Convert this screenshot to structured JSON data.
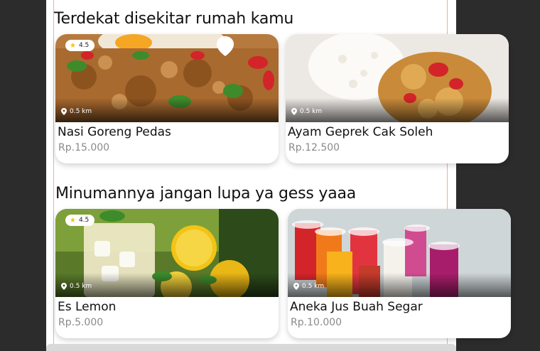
{
  "sections": [
    {
      "title": "Terdekat disekitar rumah kamu",
      "cards": [
        {
          "rating": "4.5",
          "distance": "0.5 km",
          "name": "Nasi Goreng Pedas",
          "price": "Rp.15.000"
        },
        {
          "rating": "",
          "distance": "0.5 km",
          "name": "Ayam Geprek Cak Soleh",
          "price": "Rp.12.500"
        }
      ]
    },
    {
      "title": "Minumannya jangan lupa ya gess yaaa",
      "cards": [
        {
          "rating": "4.5",
          "distance": "0.5 km",
          "name": "Es Lemon",
          "price": "Rp.5.000"
        },
        {
          "rating": "",
          "distance": "0.5 km",
          "name": "Aneka Jus Buah Segar",
          "price": "Rp.10.000"
        }
      ]
    }
  ],
  "colors": {
    "star": "#f2c417",
    "guide": "#e98a7a",
    "price": "#8a8a8a"
  },
  "icons": [
    "star-icon",
    "location-pin-icon",
    "favorite-pin-icon"
  ]
}
